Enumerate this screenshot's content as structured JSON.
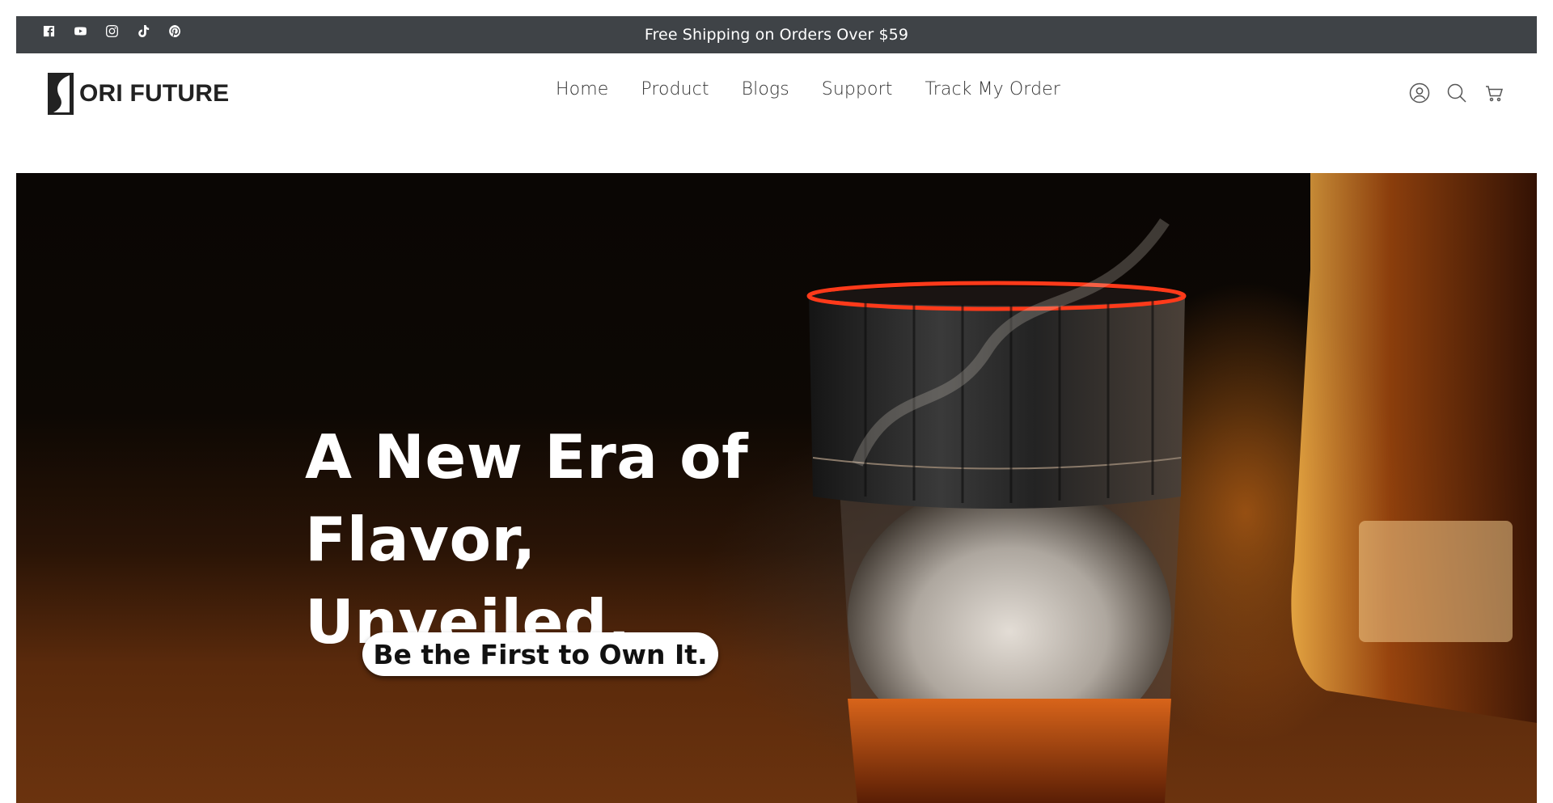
{
  "announcement": {
    "text": "Free Shipping on Orders Over $59",
    "social_icons": [
      "facebook-icon",
      "youtube-icon",
      "instagram-icon",
      "tiktok-icon",
      "pinterest-icon"
    ]
  },
  "header": {
    "logo_text": "ORI FUTURE",
    "nav": [
      "Home",
      "Product",
      "Blogs",
      "Support",
      "Track My Order"
    ],
    "icons": [
      "account-icon",
      "search-icon",
      "cart-icon"
    ]
  },
  "hero": {
    "headline_line1": "A New Era of",
    "headline_line2": "Flavor, Unveiled.",
    "cta_label": "Be the First to Own It."
  },
  "colors": {
    "announcement_bg": "#3f4347",
    "text_dark": "#333333",
    "hero_dark": "#0a0604",
    "accent_glow": "#ff3a1a"
  }
}
